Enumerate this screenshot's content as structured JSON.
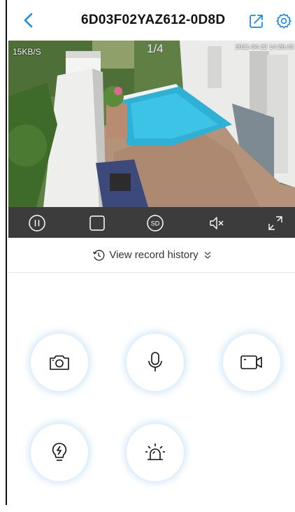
{
  "header": {
    "title": "6D03F02YAZ612-0D8D",
    "accent_color": "#1e88e5"
  },
  "video": {
    "speed": "15KB/S",
    "page_indicator": "1/4",
    "timestamp": "2021-04-22 14:26:43"
  },
  "controls": {
    "icons": [
      "pause-icon",
      "stop-icon",
      "sd-quality-icon",
      "mute-icon",
      "fullscreen-icon"
    ],
    "sd_label": "SD",
    "bar_color": "#3c3c3c"
  },
  "history": {
    "label": "View record history"
  },
  "features": {
    "icons": [
      "camera-snapshot-icon",
      "microphone-icon",
      "video-record-icon",
      "light-bulb-icon",
      "alarm-siren-icon"
    ]
  }
}
